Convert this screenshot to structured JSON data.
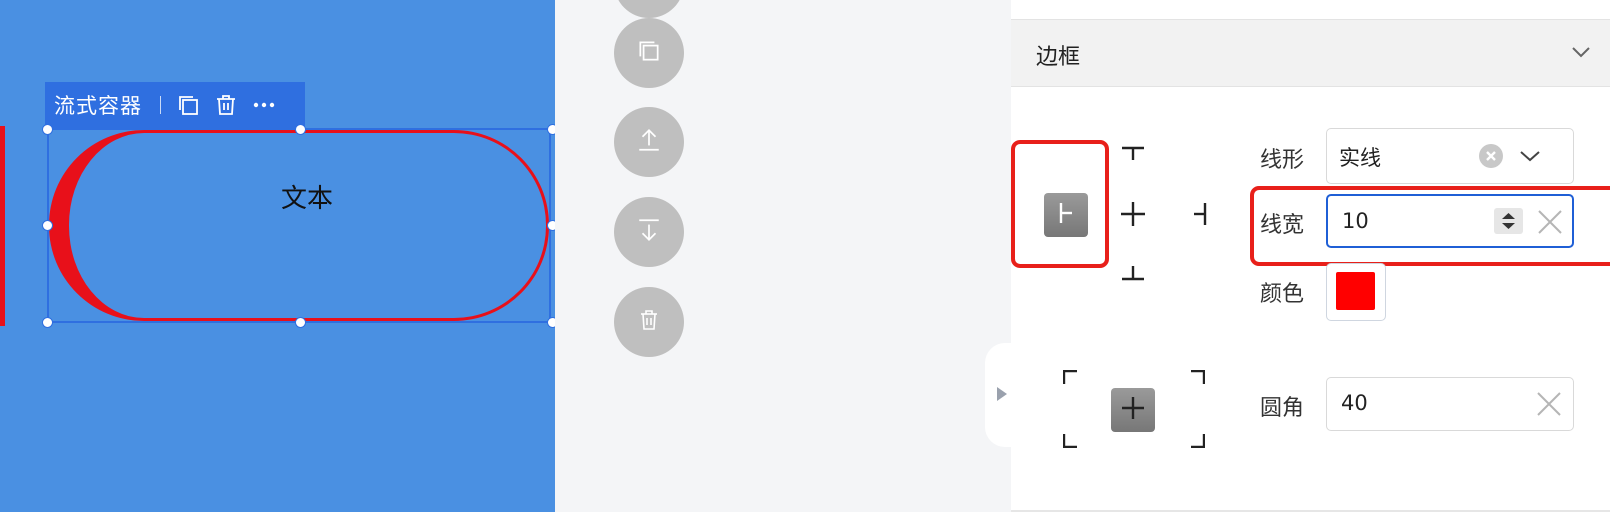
{
  "canvas": {
    "component_toolbar": {
      "component_name": "流式容器",
      "actions": [
        {
          "icon": "copy-icon"
        },
        {
          "icon": "trash-icon"
        },
        {
          "icon": "more-icon"
        }
      ]
    },
    "component_text": "文本"
  },
  "floating_actions": [
    {
      "icon": "copy-icon"
    },
    {
      "icon": "move-to-top-icon"
    },
    {
      "icon": "move-to-bottom-icon"
    },
    {
      "icon": "trash-icon"
    }
  ],
  "panel": {
    "section_title": "边框",
    "border": {
      "line_style_label": "线形",
      "line_style_value": "实线",
      "line_width_label": "线宽",
      "line_width_value": "10",
      "color_label": "颜色",
      "color_value": "#ff0000",
      "radius_label": "圆角",
      "radius_value": "40"
    }
  },
  "colors": {
    "canvas_bg": "#4a90e2",
    "border_red": "#e8101a",
    "selection_blue": "#2f6fe0",
    "focus_blue": "#1f5fd6"
  }
}
